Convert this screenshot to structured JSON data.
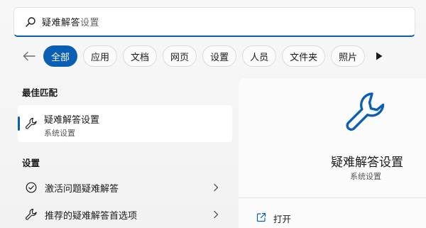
{
  "search": {
    "query_typed": "疑难解答",
    "query_rest": "设置"
  },
  "filters": {
    "chips": [
      "全部",
      "应用",
      "文档",
      "网页",
      "设置",
      "人员",
      "文件夹",
      "照片"
    ],
    "active_index": 0
  },
  "best_match": {
    "section_title": "最佳匹配",
    "title": "疑难解答设置",
    "subtitle": "系统设置"
  },
  "settings": {
    "section_title": "设置",
    "items": [
      {
        "label": "激活问题疑难解答",
        "icon": "circle-check-icon"
      },
      {
        "label": "推荐的疑难解答首选项",
        "icon": "wrench-icon"
      }
    ]
  },
  "detail": {
    "title": "疑难解答设置",
    "subtitle": "系统设置",
    "actions": [
      {
        "label": "打开",
        "icon": "open-external-icon"
      }
    ]
  },
  "colors": {
    "accent": "#0a5fb4",
    "background": "#f3f3f3"
  }
}
